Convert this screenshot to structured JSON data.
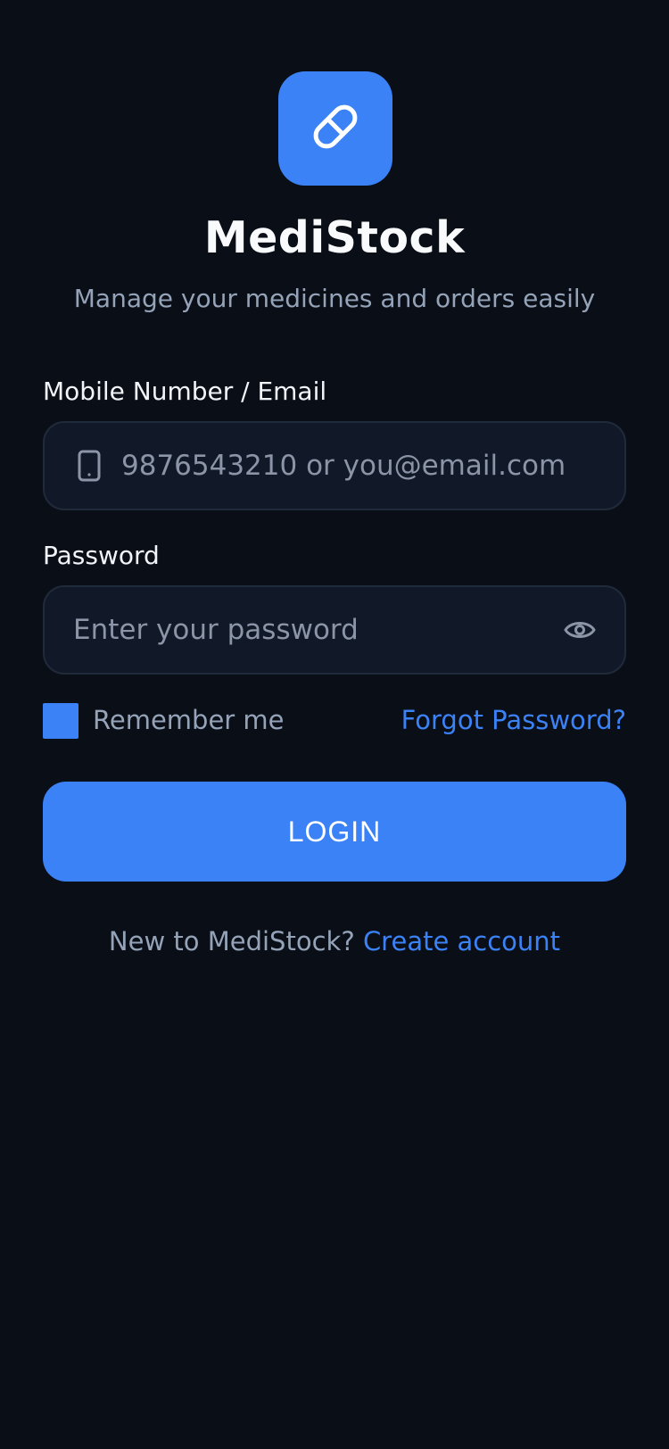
{
  "app": {
    "name": "MediStock",
    "tagline": "Manage your medicines and orders easily",
    "logo_icon": "pill-icon",
    "accent_color": "#3b82f6",
    "background_color": "#0a0e17"
  },
  "form": {
    "identity": {
      "label": "Mobile Number / Email",
      "placeholder": "9876543210 or you@email.com",
      "value": "",
      "icon": "phone-icon"
    },
    "password": {
      "label": "Password",
      "placeholder": "Enter your password",
      "value": "",
      "toggle_icon": "eye-icon"
    },
    "remember_me": {
      "label": "Remember me",
      "checked": true
    },
    "forgot_password_label": "Forgot Password?",
    "login_label": "LOGIN"
  },
  "footer": {
    "prompt": "New to MediStock?",
    "link_label": "Create account"
  }
}
